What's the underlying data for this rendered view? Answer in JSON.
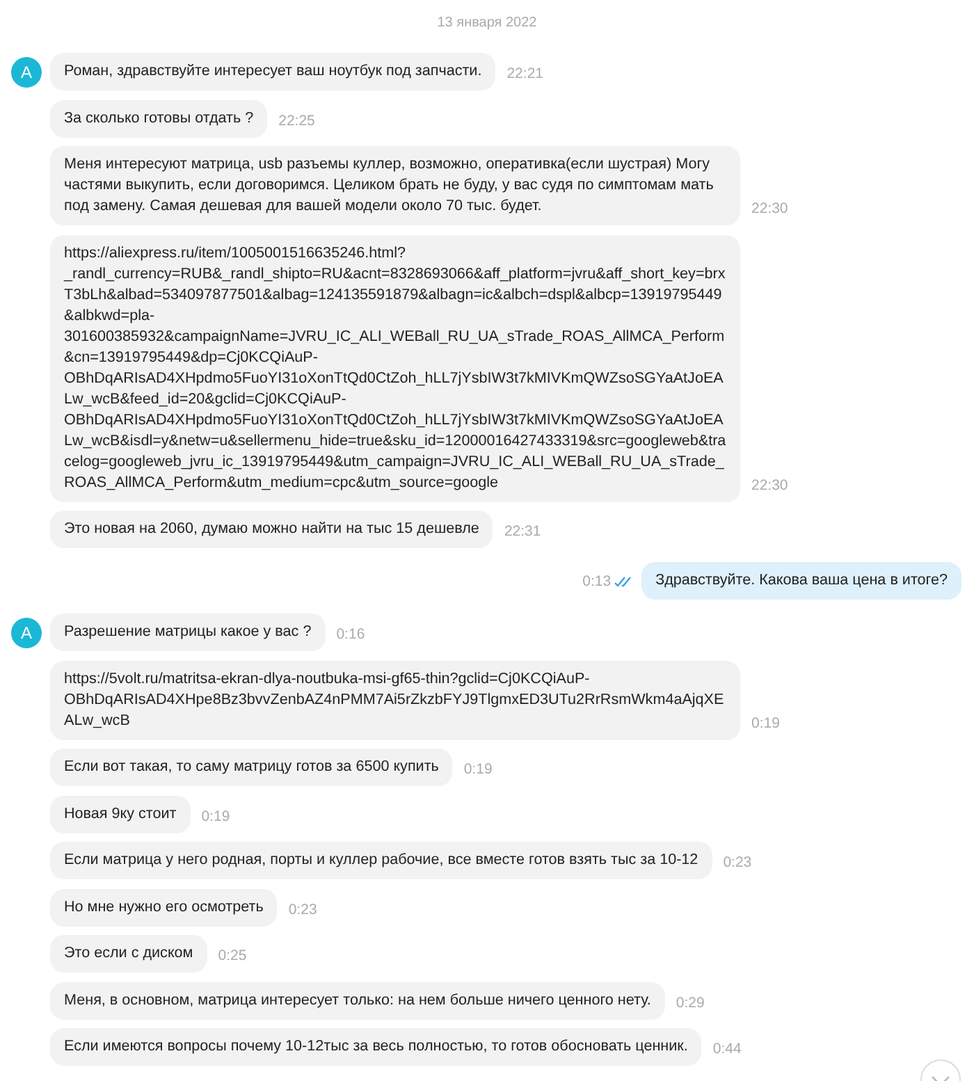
{
  "date": "13 января 2022",
  "messages": [
    {
      "kind": "in",
      "avatar": "А",
      "text": "Роман, здравствуйте интересует ваш ноутбук под запчасти.",
      "time": "22:21"
    },
    {
      "kind": "in",
      "text": "За сколько готовы отдать ?",
      "time": "22:25"
    },
    {
      "kind": "in",
      "text": "Меня интересуют матрица, usb разъемы куллер, возможно, оперативка(если шустрая) Могу частями выкупить, если договоримся. Целиком брать не буду, у вас судя по симптомам мать под замену. Самая дешевая для вашей модели около 70 тыс. будет.",
      "time": "22:30"
    },
    {
      "kind": "in",
      "text": "https://aliexpress.ru/item/1005001516635246.html?_randl_currency=RUB&_randl_shipto=RU&acnt=8328693066&aff_platform=jvru&aff_short_key=brxT3bLh&albad=534097877501&albag=124135591879&albagn=ic&albch=dspl&albcp=13919795449&albkwd=pla-301600385932&campaignName=JVRU_IC_ALI_WEBall_RU_UA_sTrade_ROAS_AllMCA_Perform&cn=13919795449&dp=Cj0KCQiAuP-OBhDqARIsAD4XHpdmo5FuoYI31oXonTtQd0CtZoh_hLL7jYsbIW3t7kMIVKmQWZsoSGYaAtJoEALw_wcB&feed_id=20&gclid=Cj0KCQiAuP-OBhDqARIsAD4XHpdmo5FuoYI31oXonTtQd0CtZoh_hLL7jYsbIW3t7kMIVKmQWZsoSGYaAtJoEALw_wcB&isdl=y&netw=u&sellermenu_hide=true&sku_id=12000016427433319&src=googleweb&tracelog=googleweb_jvru_ic_13919795449&utm_campaign=JVRU_IC_ALI_WEBall_RU_UA_sTrade_ROAS_AllMCA_Perform&utm_medium=cpc&utm_source=google",
      "time": "22:30"
    },
    {
      "kind": "in",
      "text": "Это новая на 2060, думаю можно найти на тыс 15 дешевле",
      "time": "22:31"
    },
    {
      "kind": "out",
      "text": "Здравствуйте. Какова ваша цена в итоге?",
      "time": "0:13",
      "read": true
    },
    {
      "kind": "in",
      "avatar": "А",
      "text": "Разрешение матрицы какое у вас ?",
      "time": "0:16"
    },
    {
      "kind": "in",
      "text": "https://5volt.ru/matritsa-ekran-dlya-noutbuka-msi-gf65-thin?gclid=Cj0KCQiAuP-OBhDqARIsAD4XHpe8Bz3bvvZenbAZ4nPMM7Ai5rZkzbFYJ9TlgmxED3UTu2RrRsmWkm4aAjqXEALw_wcB",
      "time": "0:19"
    },
    {
      "kind": "in",
      "text": "Если вот такая, то саму матрицу готов за 6500 купить",
      "time": "0:19"
    },
    {
      "kind": "in",
      "text": "Новая 9ку стоит",
      "time": "0:19"
    },
    {
      "kind": "in",
      "text": "Если матрица у него родная, порты и куллер рабочие, все вместе готов взять тыс за 10-12",
      "time": "0:23"
    },
    {
      "kind": "in",
      "text": "Но мне нужно его осмотреть",
      "time": "0:23"
    },
    {
      "kind": "in",
      "text": "Это если с диском",
      "time": "0:25"
    },
    {
      "kind": "in",
      "text": "Меня, в основном, матрица интересует только: на нем больше ничего ценного нету.",
      "time": "0:29"
    },
    {
      "kind": "in",
      "text": "Если имеются вопросы почему 10-12тыс за весь полностью, то готов обосновать ценник.",
      "time": "0:44"
    }
  ]
}
